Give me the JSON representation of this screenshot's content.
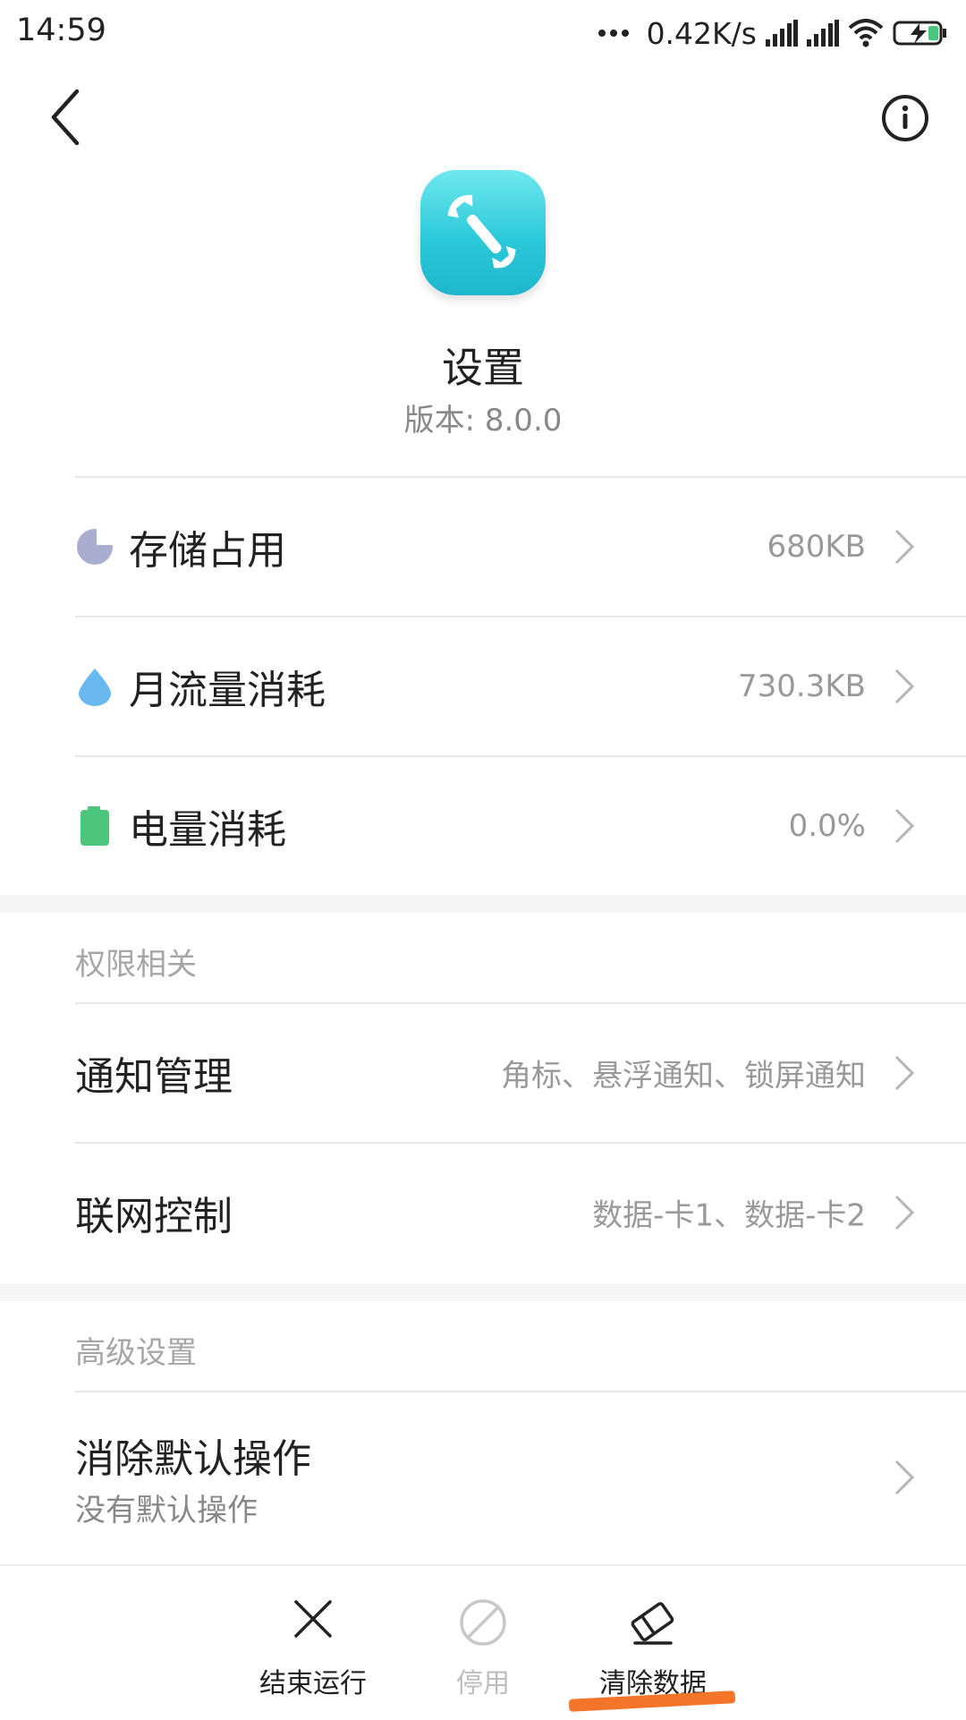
{
  "status_bar": {
    "time": "14:59",
    "network_speed": "0.42K/s",
    "icons": [
      "more-dots-icon",
      "signal-icon",
      "signal-icon",
      "wifi-icon",
      "battery-charging-icon"
    ]
  },
  "header": {
    "back_icon": "chevron-left-icon",
    "info_icon": "info-icon"
  },
  "app": {
    "name": "设置",
    "version": "版本: 8.0.0",
    "icon": "wrench-icon",
    "icon_color": "#2cc9da"
  },
  "usage": [
    {
      "label": "存储占用",
      "value": "680KB",
      "icon": "pie-chart-icon",
      "icon_color": "#a9aed0"
    },
    {
      "label": "月流量消耗",
      "value": "730.3KB",
      "icon": "water-drop-icon",
      "icon_color": "#6ab8f0"
    },
    {
      "label": "电量消耗",
      "value": "0.0%",
      "icon": "battery-icon",
      "icon_color": "#4cc67d"
    }
  ],
  "permissions": {
    "title": "权限相关",
    "items": [
      {
        "label": "通知管理",
        "value": "角标、悬浮通知、锁屏通知"
      },
      {
        "label": "联网控制",
        "value": "数据-卡1、数据-卡2"
      }
    ]
  },
  "advanced": {
    "title": "高级设置",
    "items": [
      {
        "label": "消除默认操作",
        "sub": "没有默认操作"
      }
    ]
  },
  "bottom_bar": {
    "buttons": [
      {
        "label": "结束运行",
        "icon": "close-icon",
        "enabled": true
      },
      {
        "label": "停用",
        "icon": "disable-icon",
        "enabled": false
      },
      {
        "label": "清除数据",
        "icon": "eraser-icon",
        "enabled": true
      }
    ],
    "highlight_color": "#f4752a"
  }
}
